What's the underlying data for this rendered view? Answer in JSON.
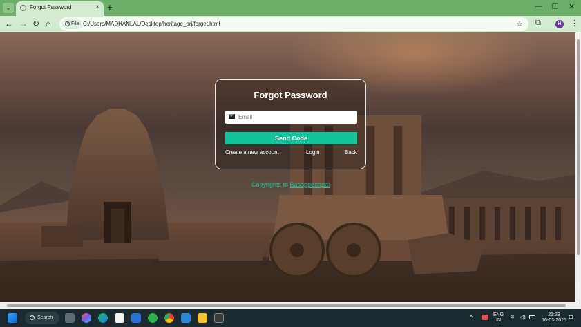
{
  "browser": {
    "tab_title": "Forgot Password",
    "new_tab_glyph": "+",
    "close_tab_glyph": "×",
    "file_chip": "File",
    "url": "C:/Users/MADHANLAL/Desktop/heritage_prj/forget.html",
    "profile_initial": "H",
    "icons": [
      "tab-menu-icon",
      "back-arrow-icon",
      "forward-arrow-icon",
      "reload-icon",
      "home-icon",
      "bookmark-star-icon",
      "extensions-icon",
      "kebab-menu-icon"
    ]
  },
  "form": {
    "title": "Forgot Password",
    "email_placeholder": "Email",
    "email_value": "",
    "submit_label": "Send Code",
    "create_account": "Create a new account",
    "login": "Login",
    "back": "Back"
  },
  "footer": {
    "copyright_prefix": "Copyrights to",
    "copyright_name": "Basappenapal"
  },
  "taskbar": {
    "search_label": "Search",
    "language": "ENG",
    "region": "IN",
    "time": "21:23",
    "date": "16-03-2025"
  },
  "colors": {
    "accent": "#15c39a",
    "tab_strip": "#6cae6a",
    "toolbar": "#d3ebcf",
    "taskbar": "#1a2a2f"
  }
}
